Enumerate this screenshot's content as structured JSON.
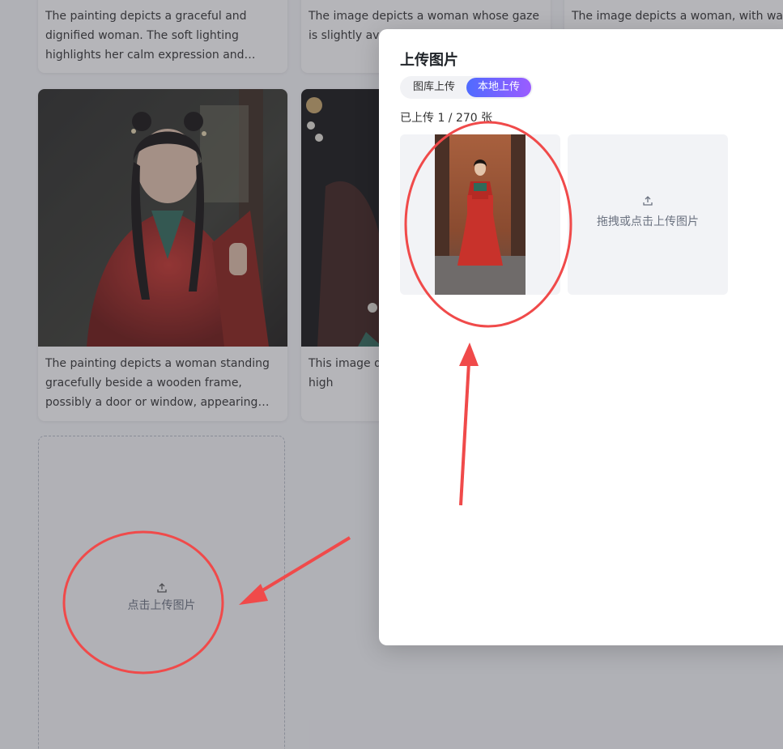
{
  "gallery": {
    "cards": [
      {
        "description": "The painting depicts a graceful and dignified woman. The soft lighting highlights her calm expression and gentl..."
      },
      {
        "description": "The image depicts a woman whose gaze is slightly ave... a sense of ca"
      },
      {
        "description": "The image depicts a woman, with warr"
      },
      {
        "description": "The painting depicts a woman standing gracefully beside a wooden frame, possibly a door or window, appearing ve..."
      },
      {
        "description": "This image d... classical bea... delicate, high"
      }
    ],
    "upload_card": {
      "label": "点击上传图片"
    }
  },
  "modal": {
    "title": "上传图片",
    "tabs": [
      {
        "label": "图库上传",
        "active": false
      },
      {
        "label": "本地上传",
        "active": true
      }
    ],
    "uploaded_count": "已上传 1 / 270 张",
    "dropzone_label": "拖拽或点击上传图片"
  },
  "colors": {
    "accent_start": "#4f6bff",
    "accent_end": "#9b5cff",
    "annotation": "#f04a4a"
  }
}
